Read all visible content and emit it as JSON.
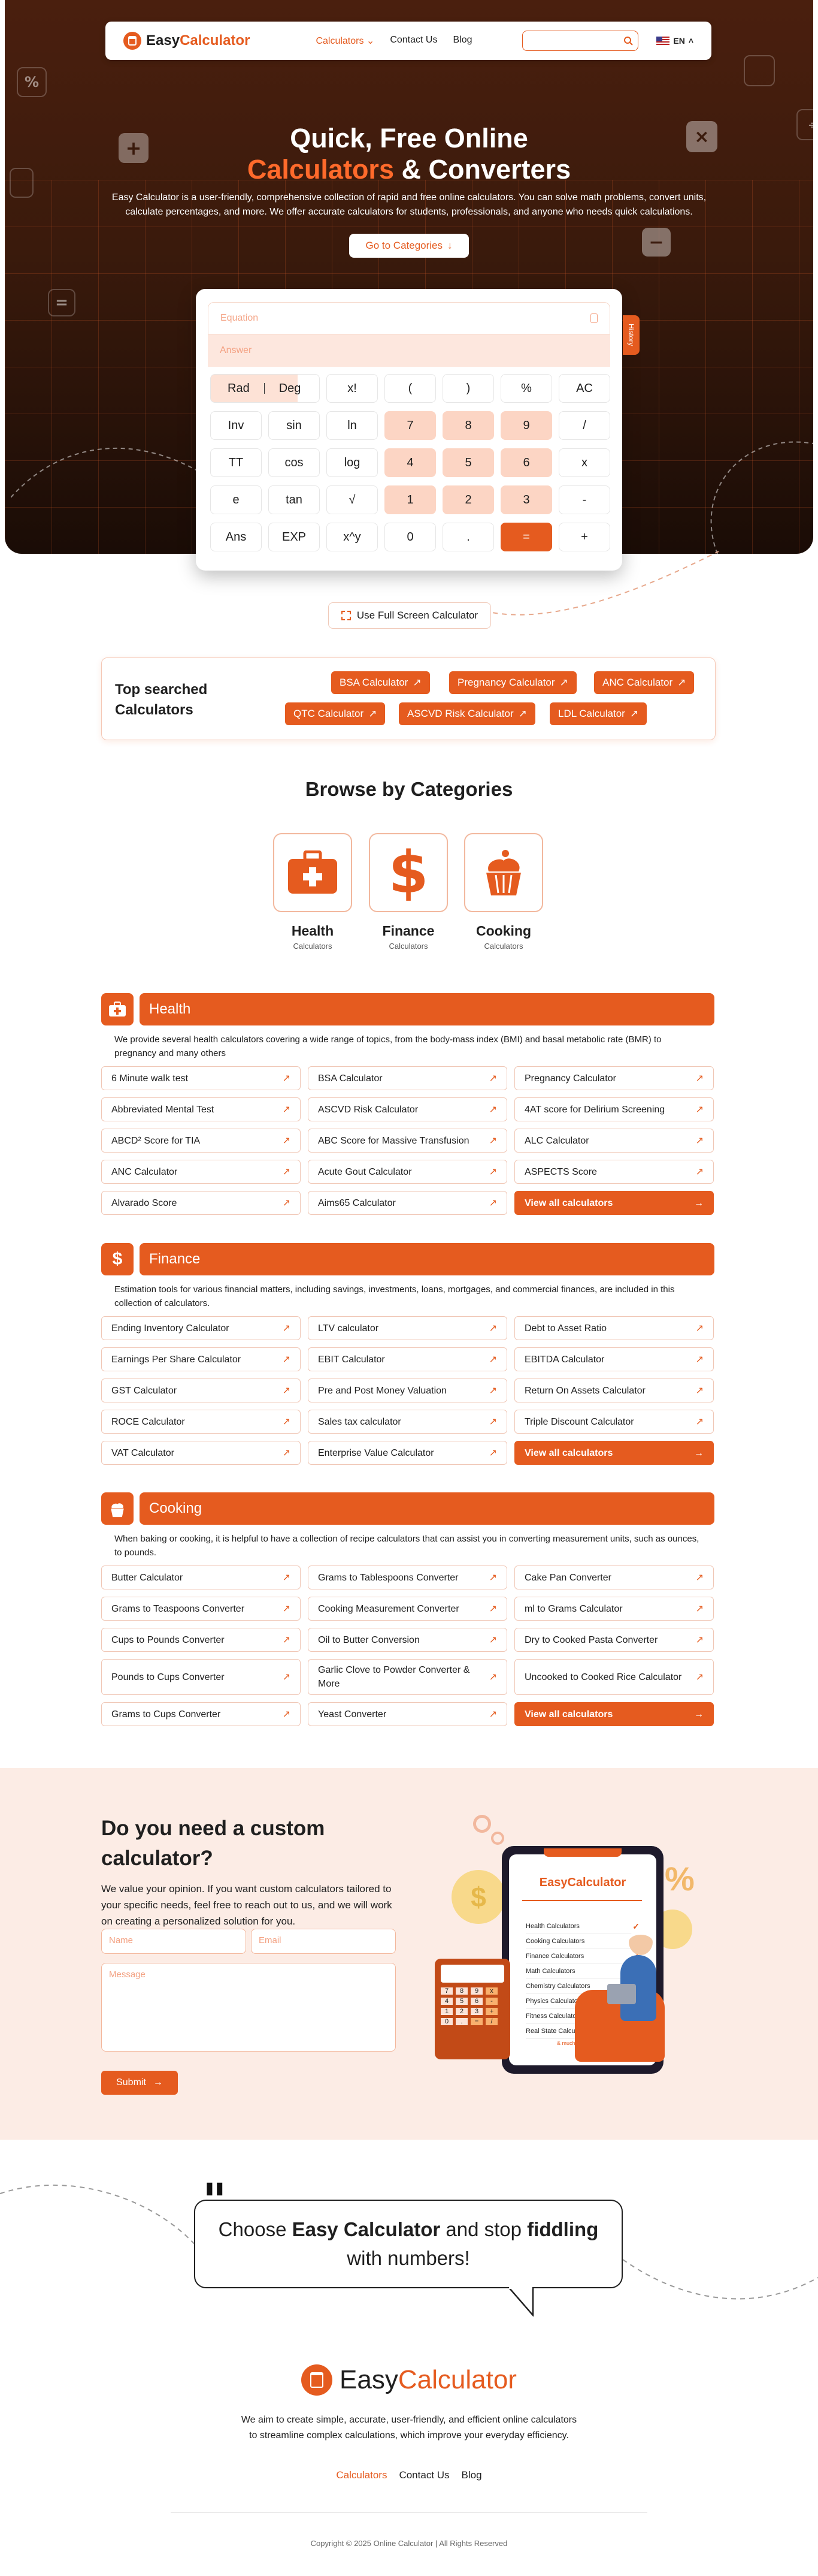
{
  "nav": {
    "logo_part1": "Easy",
    "logo_part2": "Calculator",
    "links": [
      "Calculators",
      "Contact Us",
      "Blog"
    ],
    "lang": "EN"
  },
  "hero": {
    "title_line1": "Quick, Free Online",
    "title_accent": "Calculators",
    "title_rest": "& Converters",
    "description": "Easy Calculator is a user-friendly, comprehensive collection of rapid and free online calculators. You can solve math problems, convert units, calculate percentages, and more. We offer accurate calculators for students, professionals, and anyone who needs quick calculations.",
    "cta": "Go to Categories"
  },
  "calculator": {
    "equation_placeholder": "Equation",
    "answer_placeholder": "Answer",
    "history_label": "History",
    "rows": [
      [
        "Rad|Deg",
        "x!",
        "(",
        ")",
        "%",
        "AC"
      ],
      [
        "Inv",
        "sin",
        "ln",
        "7",
        "8",
        "9",
        "/"
      ],
      [
        "TT",
        "cos",
        "log",
        "4",
        "5",
        "6",
        "x"
      ],
      [
        "e",
        "tan",
        "√",
        "1",
        "2",
        "3",
        "-"
      ],
      [
        "Ans",
        "EXP",
        "x^y",
        "0",
        ".",
        "=",
        "+"
      ]
    ],
    "fullscreen_label": "Use Full Screen Calculator"
  },
  "top_searched": {
    "title": "Top searched Calculators",
    "chips": [
      "BSA Calculator",
      "Pregnancy Calculator",
      "ANC Calculator",
      "QTC Calculator",
      "ASCVD Risk Calculator",
      "LDL Calculator"
    ]
  },
  "browse": {
    "title": "Browse by Categories",
    "categories": [
      {
        "name": "Health",
        "sub": "Calculators"
      },
      {
        "name": "Finance",
        "sub": "Calculators"
      },
      {
        "name": "Cooking",
        "sub": "Calculators"
      }
    ]
  },
  "sections": [
    {
      "title": "Health",
      "description": "We provide several health calculators covering a wide range of topics, from the body-mass index (BMI) and basal metabolic rate (BMR) to pregnancy and many others",
      "items": [
        "6 Minute walk test",
        "BSA Calculator",
        "Pregnancy Calculator",
        "Abbreviated Mental Test",
        "ASCVD Risk Calculator",
        "4AT score for Delirium Screening",
        "ABCD² Score for TIA",
        "ABC Score for Massive Transfusion",
        "ALC Calculator",
        "ANC Calculator",
        "Acute Gout Calculator",
        "ASPECTS Score",
        "Alvarado Score",
        "Aims65 Calculator"
      ],
      "view_all": "View all calculators"
    },
    {
      "title": "Finance",
      "description": "Estimation tools for various financial matters, including savings, investments, loans, mortgages, and commercial finances, are included in this collection of calculators.",
      "items": [
        "Ending Inventory Calculator",
        "LTV calculator",
        "Debt to Asset Ratio",
        "Earnings Per Share Calculator",
        "EBIT Calculator",
        "EBITDA Calculator",
        "GST Calculator",
        "Pre and Post Money Valuation",
        "Return On Assets Calculator",
        "ROCE Calculator",
        "Sales tax calculator",
        "Triple Discount Calculator",
        "VAT Calculator",
        "Enterprise Value Calculator"
      ],
      "view_all": "View all calculators"
    },
    {
      "title": "Cooking",
      "description": "When baking or cooking, it is helpful to have a collection of recipe calculators that can assist you in converting measurement units, such as ounces, to pounds.",
      "items": [
        "Butter Calculator",
        "Grams to Tablespoons Converter",
        "Cake Pan Converter",
        "Grams to Teaspoons Converter",
        "Cooking Measurement Converter",
        "ml to Grams Calculator",
        "Cups to Pounds Converter",
        "Oil to Butter Conversion",
        "Dry to Cooked Pasta Converter",
        "Pounds to Cups Converter",
        "Garlic Clove to Powder Converter & More",
        "Uncooked to Cooked Rice Calculator",
        "Grams to Cups Converter",
        "Yeast Converter"
      ],
      "view_all": "View all calculators"
    }
  ],
  "custom": {
    "title": "Do you need a custom calculator?",
    "description": "We value your opinion. If you want custom calculators tailored to your specific needs, feel free to reach out to us, and we will work on creating a personalized solution for you.",
    "name_placeholder": "Name",
    "email_placeholder": "Email",
    "message_placeholder": "Message",
    "submit": "Submit"
  },
  "illustration": {
    "header": "EasyCalculator",
    "list": [
      "Health Calculators",
      "Cooking Calculators",
      "Finance Calculators",
      "Math Calculators",
      "Chemistry Calculators",
      "Physics Calculators",
      "Fitness Calculators",
      "Real State Calculators"
    ],
    "more": "& much more"
  },
  "quote": {
    "part1": "Choose ",
    "bold1": "Easy Calculator",
    "part2": " and stop ",
    "bold2": "fiddling",
    "part3": "with numbers!"
  },
  "footer": {
    "logo_part1": "Easy",
    "logo_part2": "Calculator",
    "description": "We aim to create simple, accurate, user-friendly, and efficient online calculators to streamline complex calculations, which improve your everyday efficiency.",
    "links": [
      "Calculators",
      "Contact Us",
      "Blog"
    ],
    "copyright": "Copyright © 2025 Online Calculator | All Rights Reserved"
  },
  "colors": {
    "accent": "#e55b1f",
    "hero_dark": "#3a1a0c",
    "soft_bg": "#fcece5"
  }
}
